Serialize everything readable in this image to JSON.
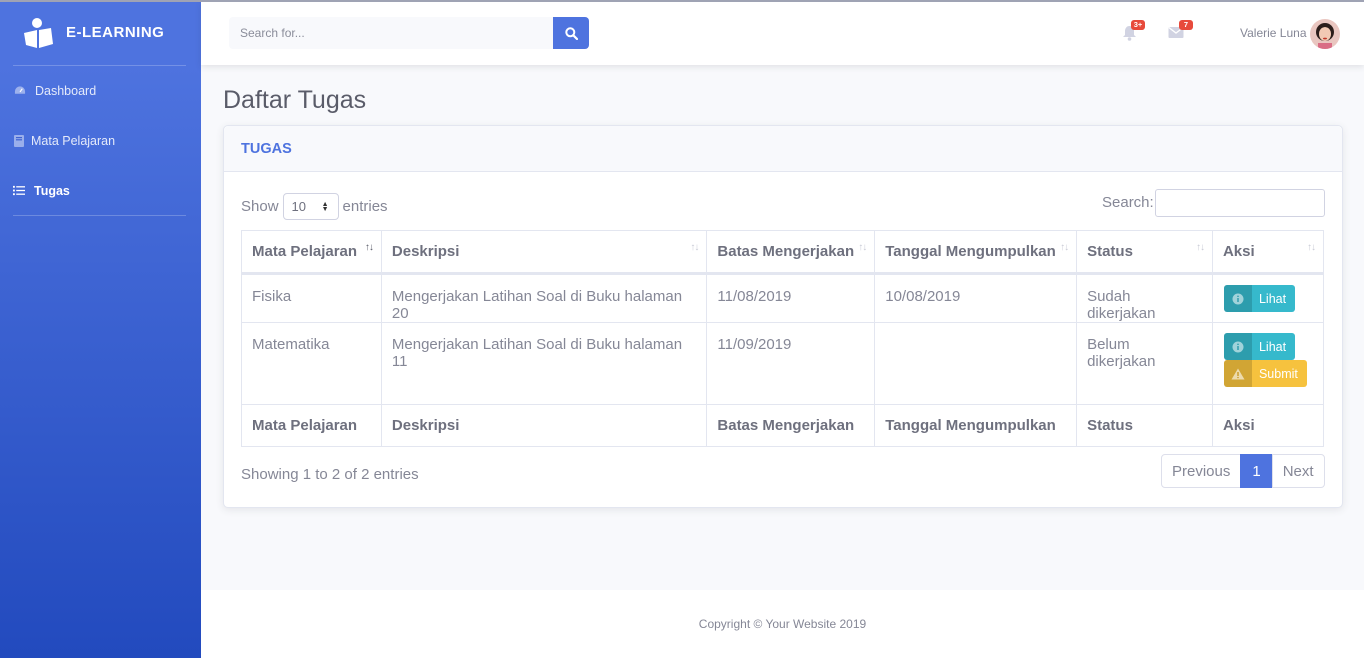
{
  "brand": {
    "title": "E-LEARNING",
    "logo_icon": "book-reader-icon"
  },
  "sidebar": {
    "items": [
      {
        "label": "Dashboard",
        "icon": "tachometer-icon",
        "active": false
      },
      {
        "label": "Mata Pelajaran",
        "icon": "book-icon",
        "active": false
      },
      {
        "label": "Tugas",
        "icon": "tasks-list-icon",
        "active": true
      }
    ]
  },
  "topbar": {
    "search_placeholder": "Search for...",
    "alerts_badge": "3+",
    "messages_badge": "7",
    "user_name": "Valerie Luna"
  },
  "page": {
    "title": "Daftar Tugas"
  },
  "card": {
    "header": "TUGAS",
    "length": {
      "show_label": "Show",
      "value": "10",
      "entries_label": "entries"
    },
    "search_label": "Search:",
    "columns": [
      "Mata Pelajaran",
      "Deskripsi",
      "Batas Mengerjakan",
      "Tanggal Mengumpulkan",
      "Status",
      "Aksi"
    ],
    "rows": [
      {
        "mapel": "Fisika",
        "deskripsi": "Mengerjakan Latihan Soal di Buku halaman 20",
        "batas": "11/08/2019",
        "tanggal": "10/08/2019",
        "status": "Sudah dikerjakan",
        "actions": [
          "Lihat"
        ]
      },
      {
        "mapel": "Matematika",
        "deskripsi": "Mengerjakan Latihan Soal di Buku halaman 11",
        "batas": "11/09/2019",
        "tanggal": "",
        "status": "Belum dikerjakan",
        "actions": [
          "Lihat",
          "Submit"
        ]
      }
    ],
    "info": "Showing 1 to 2 of 2 entries",
    "pagination": {
      "previous": "Previous",
      "current": "1",
      "next": "Next"
    }
  },
  "footer": {
    "text": "Copyright © Your Website 2019"
  },
  "colors": {
    "primary": "#4e73df",
    "info": "#36b9cc",
    "warning": "#f6c23e",
    "danger": "#e74a3b"
  }
}
